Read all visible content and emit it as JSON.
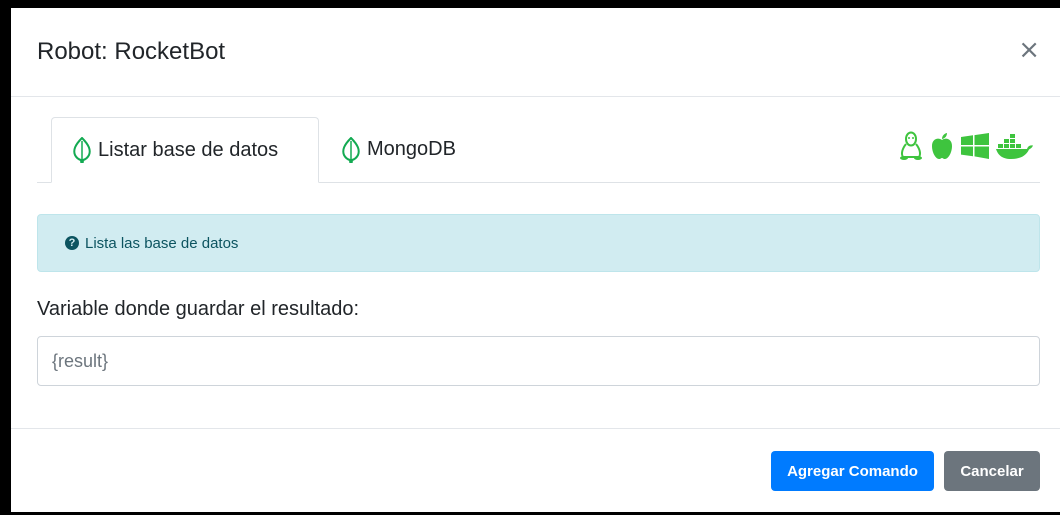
{
  "modal": {
    "title": "Robot: RocketBot",
    "close_symbol": "×"
  },
  "tabs": [
    {
      "label": "Listar base de datos",
      "icon": "leaf-icon",
      "active": true
    },
    {
      "label": "MongoDB",
      "icon": "leaf-icon",
      "active": false
    }
  ],
  "os_icons": [
    "linux-icon",
    "apple-icon",
    "windows-icon",
    "docker-icon"
  ],
  "alert": {
    "icon": "question-circle-icon",
    "text": "Lista las base de datos"
  },
  "form": {
    "label": "Variable donde guardar el resultado:",
    "placeholder": "{result}",
    "value": ""
  },
  "footer": {
    "add_label": "Agregar Comando",
    "cancel_label": "Cancelar"
  },
  "colors": {
    "primary": "#007bff",
    "secondary": "#6c757d",
    "alert_bg": "#d1ecf1",
    "leaf_green": "#13aa52",
    "os_green": "#3ec43e"
  }
}
